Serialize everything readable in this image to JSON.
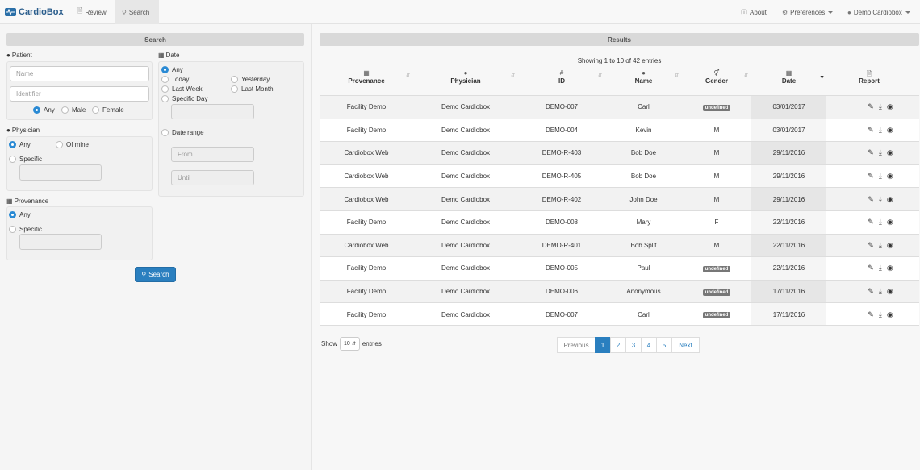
{
  "navbar": {
    "brand": "CardioBox",
    "tabs": [
      {
        "label": "Review",
        "icon": "file-icon"
      },
      {
        "label": "Search",
        "icon": "search-icon"
      }
    ],
    "right": [
      {
        "label": "About",
        "icon": "info-icon"
      },
      {
        "label": "Preferences",
        "icon": "gears-icon"
      },
      {
        "label": "Demo Cardiobox",
        "icon": "user-icon"
      }
    ]
  },
  "search": {
    "header": "Search",
    "patient": {
      "label": "Patient",
      "name_placeholder": "Name",
      "identifier_placeholder": "Identifier",
      "gender_options": [
        "Any",
        "Male",
        "Female"
      ],
      "gender_selected": "Any"
    },
    "date": {
      "label": "Date",
      "options": [
        "Any",
        "Today",
        "Yesterday",
        "Last Week",
        "Last Month",
        "Specific Day"
      ],
      "selected": "Any",
      "range_label": "Date range",
      "from_placeholder": "From",
      "until_placeholder": "Until"
    },
    "physician": {
      "label": "Physician",
      "options": [
        "Any",
        "Of mine",
        "Specific"
      ],
      "selected": "Any"
    },
    "provenance": {
      "label": "Provenance",
      "options": [
        "Any",
        "Specific"
      ],
      "selected": "Any"
    },
    "button": "Search"
  },
  "results": {
    "header": "Results",
    "showing": "Showing 1 to 10 of 42 entries",
    "columns": [
      "Provenance",
      "Physician",
      "ID",
      "Name",
      "Gender",
      "Date",
      "Report"
    ],
    "rows": [
      {
        "provenance": "Facility Demo",
        "physician": "Demo Cardiobox",
        "id": "DEMO-007",
        "name": "Carl",
        "gender": "undefined",
        "date": "03/01/2017"
      },
      {
        "provenance": "Facility Demo",
        "physician": "Demo Cardiobox",
        "id": "DEMO-004",
        "name": "Kevin",
        "gender": "M",
        "date": "03/01/2017"
      },
      {
        "provenance": "Cardiobox Web",
        "physician": "Demo Cardiobox",
        "id": "DEMO-R-403",
        "name": "Bob Doe",
        "gender": "M",
        "date": "29/11/2016"
      },
      {
        "provenance": "Cardiobox Web",
        "physician": "Demo Cardiobox",
        "id": "DEMO-R-405",
        "name": "Bob Doe",
        "gender": "M",
        "date": "29/11/2016"
      },
      {
        "provenance": "Cardiobox Web",
        "physician": "Demo Cardiobox",
        "id": "DEMO-R-402",
        "name": "John Doe",
        "gender": "M",
        "date": "29/11/2016"
      },
      {
        "provenance": "Facility Demo",
        "physician": "Demo Cardiobox",
        "id": "DEMO-008",
        "name": "Mary",
        "gender": "F",
        "date": "22/11/2016"
      },
      {
        "provenance": "Cardiobox Web",
        "physician": "Demo Cardiobox",
        "id": "DEMO-R-401",
        "name": "Bob Split",
        "gender": "M",
        "date": "22/11/2016"
      },
      {
        "provenance": "Facility Demo",
        "physician": "Demo Cardiobox",
        "id": "DEMO-005",
        "name": "Paul",
        "gender": "undefined",
        "date": "22/11/2016"
      },
      {
        "provenance": "Facility Demo",
        "physician": "Demo Cardiobox",
        "id": "DEMO-006",
        "name": "Anonymous",
        "gender": "undefined",
        "date": "17/11/2016"
      },
      {
        "provenance": "Facility Demo",
        "physician": "Demo Cardiobox",
        "id": "DEMO-007",
        "name": "Carl",
        "gender": "undefined",
        "date": "17/11/2016"
      }
    ],
    "show_label": "Show",
    "entries_value": "10",
    "entries_label": "entries",
    "pagination": [
      "Previous",
      "1",
      "2",
      "3",
      "4",
      "5",
      "Next"
    ],
    "current_page": "1"
  },
  "colors": {
    "primary": "#2a7fbf",
    "badge": "#777777"
  }
}
